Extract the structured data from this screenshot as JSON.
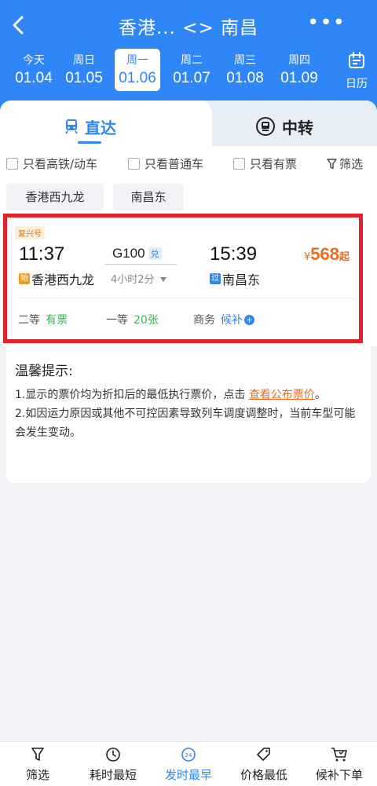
{
  "header": {
    "title": "香港... <> 南昌",
    "more": "•••",
    "calendar_label": "日历"
  },
  "dates": [
    {
      "weekday": "今天",
      "date": "01.04",
      "active": false
    },
    {
      "weekday": "周日",
      "date": "01.05",
      "active": false
    },
    {
      "weekday": "周一",
      "date": "01.06",
      "active": true
    },
    {
      "weekday": "周二",
      "date": "01.07",
      "active": false
    },
    {
      "weekday": "周三",
      "date": "01.08",
      "active": false
    },
    {
      "weekday": "周四",
      "date": "01.09",
      "active": false
    }
  ],
  "tabs": {
    "direct": "直达",
    "transfer": "中转"
  },
  "filters": {
    "high_speed_only": "只看高铁/动车",
    "regular_only": "只看普通车",
    "available_only": "只看有票",
    "filter": "筛选"
  },
  "stations": {
    "from": "香港西九龙",
    "to": "南昌东"
  },
  "train": {
    "badge": "复兴号",
    "dep_time": "11:37",
    "number": "G100",
    "redeem_tag": "兑",
    "duration": "4小时2分",
    "arr_time": "15:39",
    "price_symbol": "¥",
    "price": "568",
    "price_suffix": "起",
    "dep_station_tag": "始",
    "dep_station": "香港西九龙",
    "arr_station_tag": "过",
    "arr_station": "南昌东",
    "seats": [
      {
        "class": "二等",
        "availability": "有票"
      },
      {
        "class": "一等",
        "availability": "20张"
      },
      {
        "class": "商务",
        "availability": "候补"
      }
    ]
  },
  "tips": {
    "title": "温馨提示:",
    "line1_pre": "1.显示的票价均为折扣后的最低执行票价，点击 ",
    "line1_link": "查看公布票价",
    "line1_post": "。",
    "line2": "2.如因运力原因或其他不可控因素导致列车调度调整时，当前车型可能会发生变动。"
  },
  "bottom_bar": [
    {
      "label": "筛选",
      "icon": "filter-icon",
      "active": false
    },
    {
      "label": "耗时最短",
      "icon": "timer-icon",
      "active": false
    },
    {
      "label": "发时最早",
      "icon": "clock-24-icon",
      "active": true
    },
    {
      "label": "价格最低",
      "icon": "price-tag-icon",
      "active": false
    },
    {
      "label": "候补下单",
      "icon": "cart-icon",
      "active": false
    }
  ],
  "colors": {
    "brand_blue": "#2f86f6",
    "price_orange": "#f26b1d",
    "available_green": "#2eb84f",
    "highlight_red": "#e5202a"
  }
}
